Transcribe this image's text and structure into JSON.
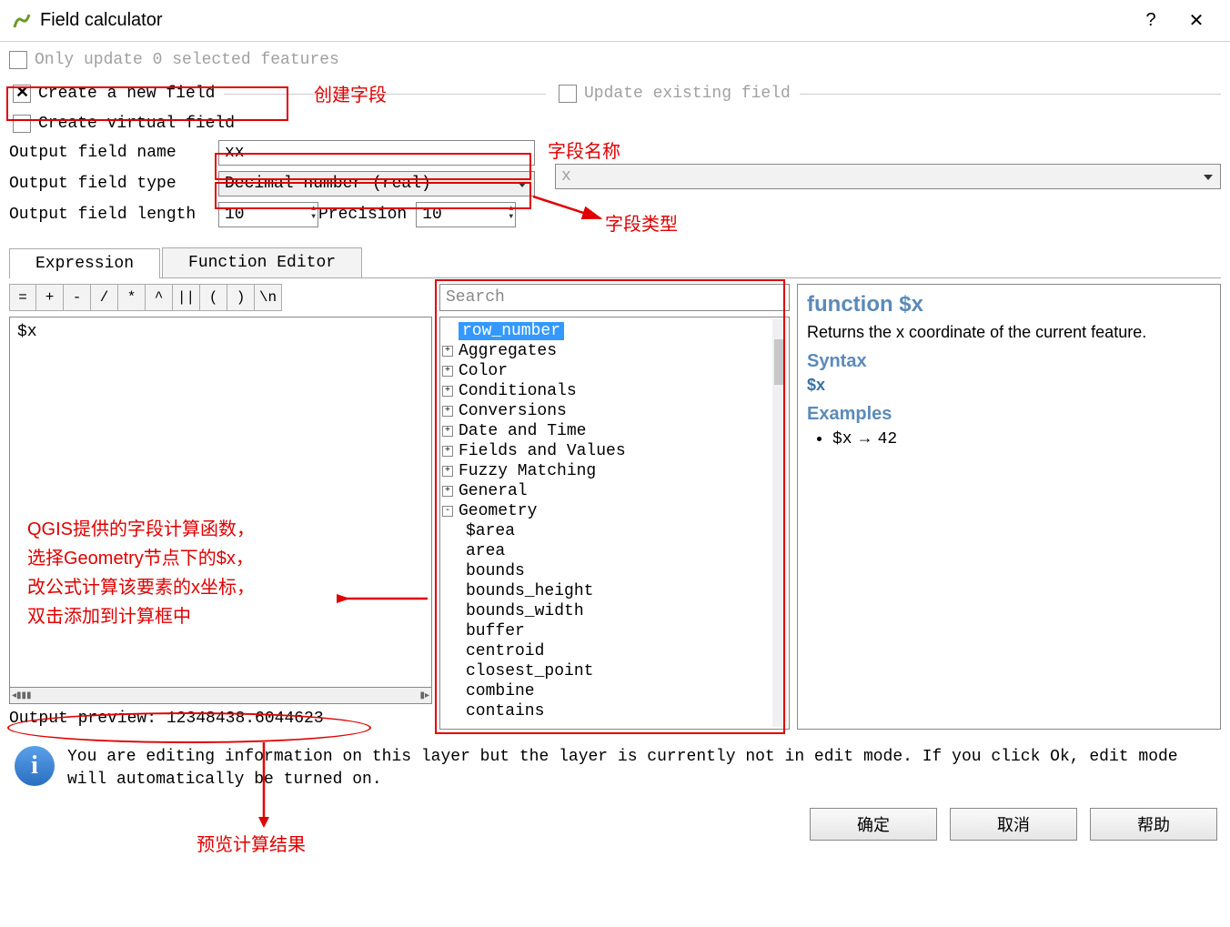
{
  "window": {
    "title": "Field calculator"
  },
  "checks": {
    "only_update": "Only update 0 selected features",
    "create_new": "Create a new field",
    "create_virtual": "Create virtual field",
    "update_existing": "Update existing field"
  },
  "form": {
    "output_name_lbl": "Output field name",
    "output_name_val": "xx",
    "output_type_lbl": "Output field type",
    "output_type_val": "Decimal number (real)",
    "output_len_lbl": "Output field length",
    "output_len_val": "10",
    "precision_lbl": " Precision",
    "precision_val": "10",
    "existing_field_val": "x"
  },
  "tabs": {
    "expr": "Expression",
    "func": "Function Editor"
  },
  "ops": [
    "=",
    "+",
    "-",
    "/",
    "*",
    "^",
    "||",
    "(",
    ")",
    "\\n"
  ],
  "expression": "$x",
  "preview_lbl": "Output preview: ",
  "preview_val": "12348438.6044623",
  "search_placeholder": "Search",
  "tree": {
    "row_number": "row_number",
    "groups": [
      "Aggregates",
      "Color",
      "Conditionals",
      "Conversions",
      "Date and Time",
      "Fields and Values",
      "Fuzzy Matching",
      "General"
    ],
    "geometry_lbl": "Geometry",
    "geom_items": [
      "$area",
      "area",
      "bounds",
      "bounds_height",
      "bounds_width",
      "buffer",
      "centroid",
      "closest_point",
      "combine",
      "contains"
    ]
  },
  "help": {
    "title": "function $x",
    "desc": "Returns the x coordinate of the current feature.",
    "syntax_h": "Syntax",
    "syntax": "$x",
    "examples_h": "Examples",
    "ex1_a": "$x",
    "ex1_b": "42"
  },
  "info": "You are editing information on this layer but the layer is currently not in edit mode. If you click Ok, edit mode will automatically be turned on.",
  "buttons": {
    "ok": "确定",
    "cancel": "取消",
    "help": "帮助"
  },
  "ann": {
    "a1": "创建字段",
    "a2": "字段名称",
    "a3": "字段类型",
    "a4": "QGIS提供的字段计算函数，\n选择Geometry节点下的$x，\n改公式计算该要素的x坐标，\n双击添加到计算框中",
    "a5": "预览计算结果"
  }
}
